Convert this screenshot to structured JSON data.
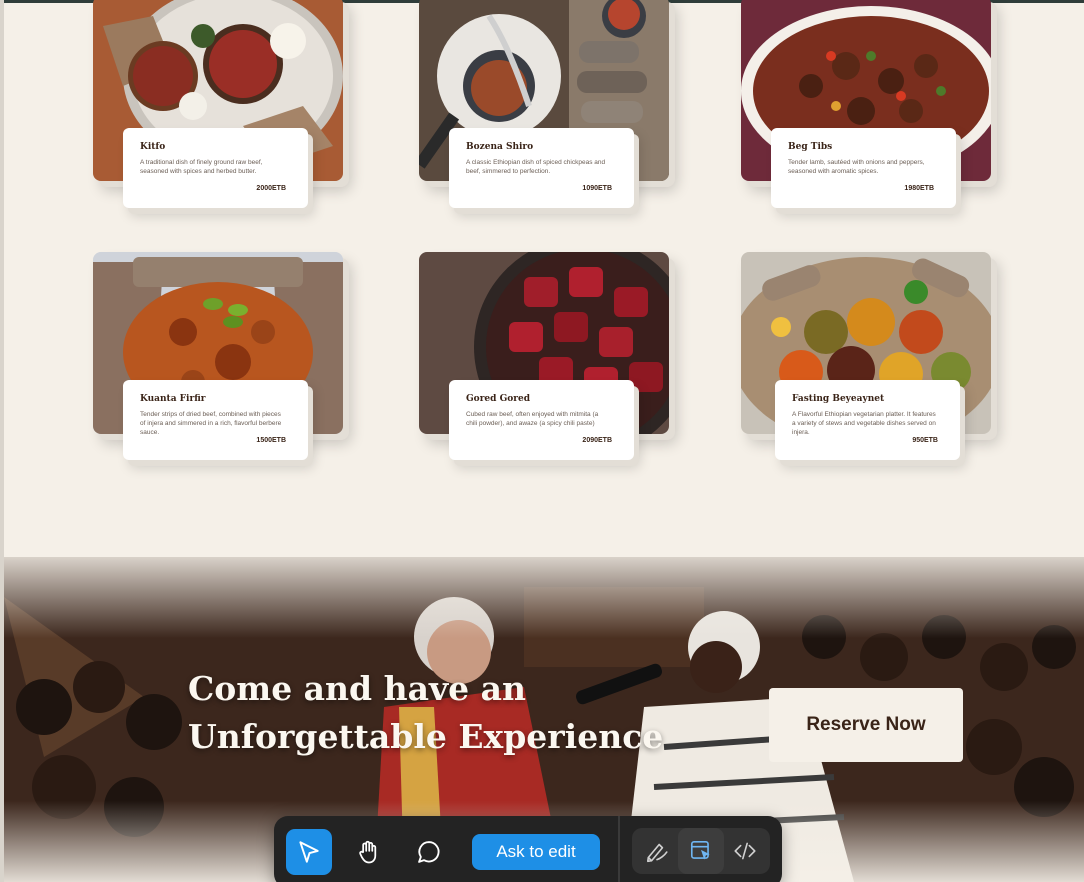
{
  "menu": {
    "items": [
      {
        "name": "Kitfo",
        "description": "A traditional dish of finely ground raw beef, seasoned with spices and herbed butter.",
        "price": "2000ETB"
      },
      {
        "name": "Bozena Shiro",
        "description": "A classic Ethiopian dish of spiced chickpeas and beef, simmered to perfection.",
        "price": "1090ETB"
      },
      {
        "name": "Beg Tibs",
        "description": "Tender lamb, sautéed with onions and peppers, seasoned with aromatic spices.",
        "price": "1980ETB"
      },
      {
        "name": "Kuanta Firfir",
        "description": "Tender strips of dried beef, combined with pieces of injera and simmered in a rich, flavorful berbere sauce.",
        "price": "1500ETB"
      },
      {
        "name": "Gored Gored",
        "description": "Cubed raw beef, often enjoyed with mitmita (a chili powder), and awaze (a spicy chili paste)",
        "price": "2090ETB"
      },
      {
        "name": "Fasting Beyeaynet",
        "description": "A Flavorful Ethiopian vegetarian platter. It features a variety of stews and vegetable dishes served on injera.",
        "price": "950ETB"
      }
    ]
  },
  "banner": {
    "headline_line1": "Come and have an",
    "headline_line2": "Unforgettable Experience",
    "reserve_label": "Reserve Now"
  },
  "toolbar": {
    "ask_label": "Ask to edit",
    "tools": [
      "select-pointer-icon",
      "hand-pan-icon",
      "comment-bubble-icon",
      "draw-pen-icon",
      "inspect-element-icon",
      "code-brackets-icon"
    ]
  },
  "colors": {
    "page_background": "#f5f0e8",
    "text_dark": "#3a2418",
    "accent_blue": "#1e8fe6",
    "toolbar_bg": "#232323"
  }
}
